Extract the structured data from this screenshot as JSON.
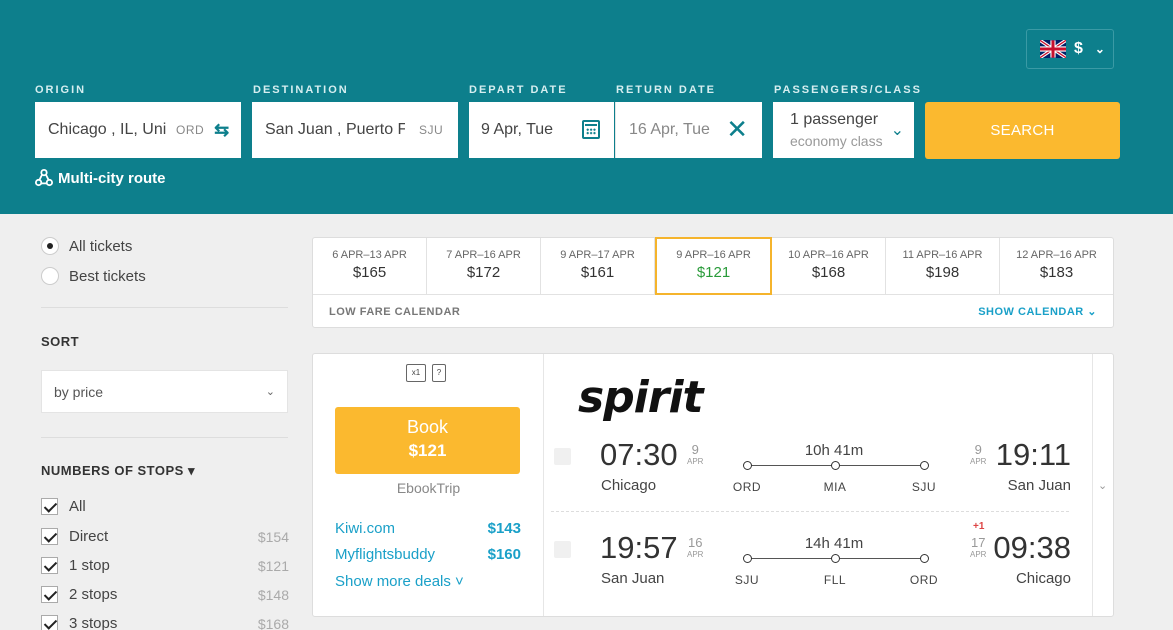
{
  "header": {
    "currency": "$",
    "origin": {
      "label": "ORIGIN",
      "value": "Chicago , IL, Uni",
      "code": "ORD"
    },
    "destination": {
      "label": "DESTINATION",
      "value": "San Juan , Puerto F",
      "code": "SJU"
    },
    "depart": {
      "label": "DEPART DATE",
      "value": "9 Apr, Tue"
    },
    "return": {
      "label": "RETURN DATE",
      "value": "16 Apr, Tue"
    },
    "passengers": {
      "label": "PASSENGERS/CLASS",
      "value": "1 passenger",
      "class": "economy class"
    },
    "search_label": "SEARCH",
    "multicity": "Multi-city route"
  },
  "sidebar": {
    "radio": [
      "All tickets",
      "Best tickets"
    ],
    "sort_title": "SORT",
    "sort_value": "by price",
    "stops_title": "NUMBERS OF STOPS ▾",
    "stops": [
      {
        "label": "All",
        "price": ""
      },
      {
        "label": "Direct",
        "price": "$154"
      },
      {
        "label": "1 stop",
        "price": "$121"
      },
      {
        "label": "2 stops",
        "price": "$148"
      },
      {
        "label": "3 stops",
        "price": "$168"
      }
    ]
  },
  "date_strip": {
    "cells": [
      {
        "range": "6 APR–13 APR",
        "price": "$165"
      },
      {
        "range": "7 APR–16 APR",
        "price": "$172"
      },
      {
        "range": "9 APR–17 APR",
        "price": "$161"
      },
      {
        "range": "9 APR–16 APR",
        "price": "$121"
      },
      {
        "range": "10 APR–16 APR",
        "price": "$168"
      },
      {
        "range": "11 APR–16 APR",
        "price": "$198"
      },
      {
        "range": "12 APR–16 APR",
        "price": "$183"
      }
    ],
    "active_index": 3,
    "low_fare": "LOW FARE CALENDAR",
    "show_calendar": "SHOW CALENDAR ⌄"
  },
  "ticket": {
    "book_label": "Book",
    "book_price": "$121",
    "agency": "EbookTrip",
    "deals": [
      {
        "name": "Kiwi.com",
        "price": "$143"
      },
      {
        "name": "Myflightsbuddy",
        "price": "$160"
      }
    ],
    "more_deals": "Show more deals ˅",
    "airline": "spirit",
    "segments": [
      {
        "dep_time": "07:30",
        "dep_day": "9",
        "dep_mon": "APR",
        "dep_city": "Chicago",
        "duration": "10h 41m",
        "airports": [
          "ORD",
          "MIA",
          "SJU"
        ],
        "arr_time": "19:11",
        "arr_day": "9",
        "arr_mon": "APR",
        "arr_city": "San Juan",
        "plus": ""
      },
      {
        "dep_time": "19:57",
        "dep_day": "16",
        "dep_mon": "APR",
        "dep_city": "San Juan",
        "duration": "14h 41m",
        "airports": [
          "SJU",
          "FLL",
          "ORD"
        ],
        "arr_time": "09:38",
        "arr_day": "17",
        "arr_mon": "APR",
        "arr_city": "Chicago",
        "plus": "+1"
      }
    ]
  },
  "colors": {
    "header_bg": "#0d7f8c",
    "accent": "#fbb92f",
    "link": "#1aa0c8",
    "best_price": "#2a9b3a"
  }
}
